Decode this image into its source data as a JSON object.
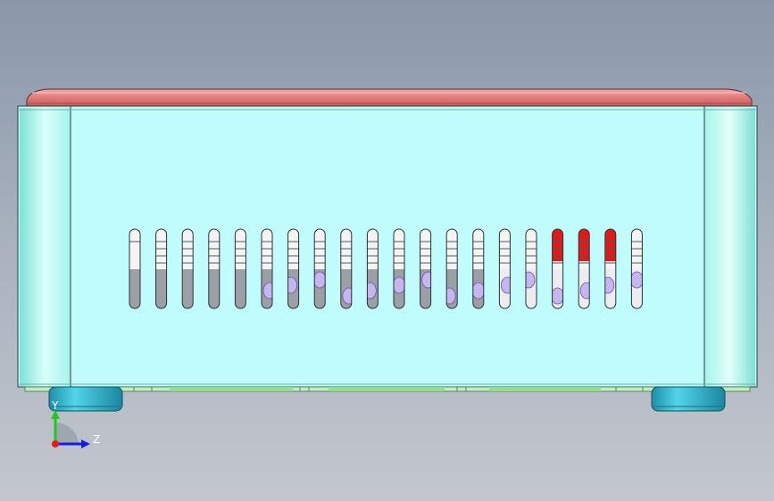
{
  "viewport": {
    "model": "enclosure-front-view",
    "colors": {
      "lid": "#e27b7b",
      "lid_edge": "#f2a3a3",
      "body": "#c0fcfc",
      "body_side": "#9fefe8",
      "feet": "#3cc2d8",
      "base_strip": "#8fde8f",
      "vent_slot": "#f4f4f4",
      "vent_fill_gray": "#9d9fa6",
      "vent_fill_red": "#e01a1a",
      "vent_fill_purple": "#c7b6ee"
    },
    "vent_slots": {
      "count": 20,
      "red_slot_indices": [
        16,
        17,
        18
      ],
      "purple_slot_indices": [
        5,
        6,
        7,
        8,
        9,
        10,
        11,
        12,
        13,
        14,
        15,
        16,
        17,
        18,
        19
      ]
    }
  },
  "triad": {
    "y_label": "Y",
    "z_label": "Z",
    "icon": "coordinate-axes-icon"
  }
}
